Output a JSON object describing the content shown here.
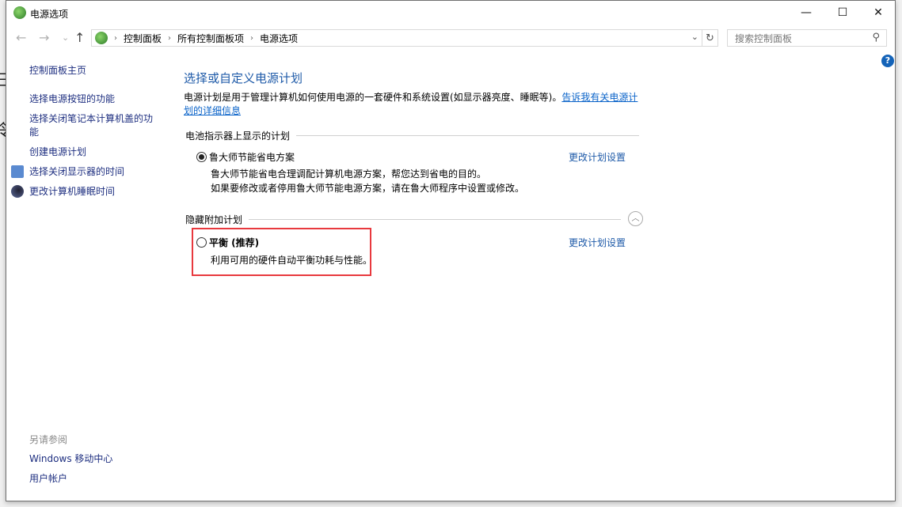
{
  "window": {
    "title": "电源选项",
    "minimize": "—",
    "maximize": "☐",
    "close": "✕"
  },
  "nav": {
    "back": "←",
    "forward": "→",
    "recent": "⌄",
    "up": "↑"
  },
  "breadcrumb": [
    "控制面板",
    "所有控制面板项",
    "电源选项"
  ],
  "search": {
    "placeholder": "搜索控制面板"
  },
  "sidebar": {
    "home": "控制面板主页",
    "items": [
      "选择电源按钮的功能",
      "选择关闭笔记本计算机盖的功能",
      "创建电源计划",
      "选择关闭显示器的时间",
      "更改计算机睡眠时间"
    ],
    "see_also": "另请参阅",
    "see_also_items": [
      "Windows 移动中心",
      "用户帐户"
    ]
  },
  "main": {
    "title": "选择或自定义电源计划",
    "description": "电源计划是用于管理计算机如何使用电源的一套硬件和系统设置(如显示器亮度、睡眠等)。",
    "learn_more": "告诉我有关电源计划的详细信息",
    "battery_group": "电池指示器上显示的计划",
    "plan1": {
      "name": "鲁大师节能省电方案",
      "desc1": "鲁大师节能省电合理调配计算机电源方案，帮您达到省电的目的。",
      "desc2": "如果要修改或者停用鲁大师节能电源方案，请在鲁大师程序中设置或修改。",
      "link": "更改计划设置",
      "selected": true
    },
    "hidden_group": "隐藏附加计划",
    "plan2": {
      "name": "平衡 (推荐)",
      "desc": "利用可用的硬件自动平衡功耗与性能。",
      "link": "更改计划设置",
      "selected": false
    }
  },
  "highlight_color": "#e8393e"
}
